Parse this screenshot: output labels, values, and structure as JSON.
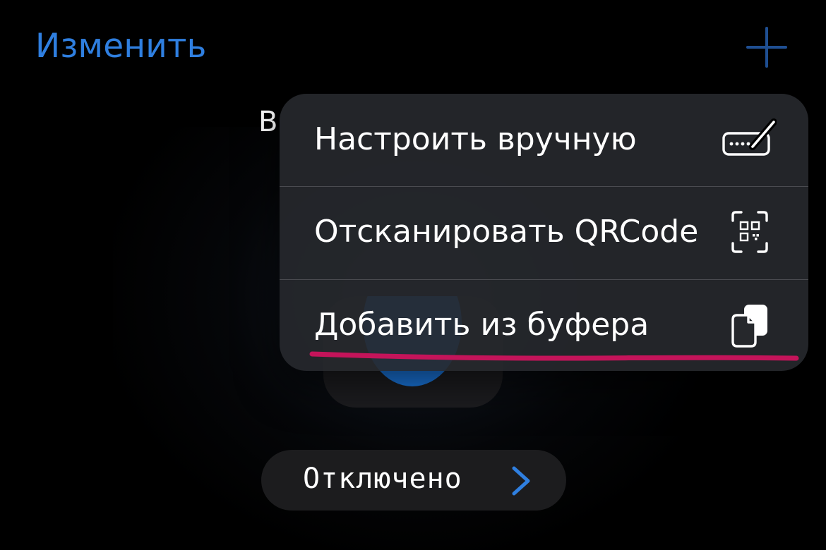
{
  "header": {
    "edit_label": "Изменить",
    "add_icon": "plus-icon"
  },
  "background": {
    "partial_text": "В",
    "status_label": "Отключено",
    "status_chevron_icon": "chevron-right-icon"
  },
  "menu": {
    "items": [
      {
        "label": "Настроить вручную",
        "icon": "keyboard-pencil-icon"
      },
      {
        "label": "Отсканировать QRCode",
        "icon": "qr-code-scan-icon"
      },
      {
        "label": "Добавить из буфера",
        "icon": "clipboard-icon"
      }
    ],
    "highlight_color": "#c4145a"
  },
  "colors": {
    "accent": "#2f7fe0",
    "background": "#000000",
    "menu_background": "#26282c"
  }
}
